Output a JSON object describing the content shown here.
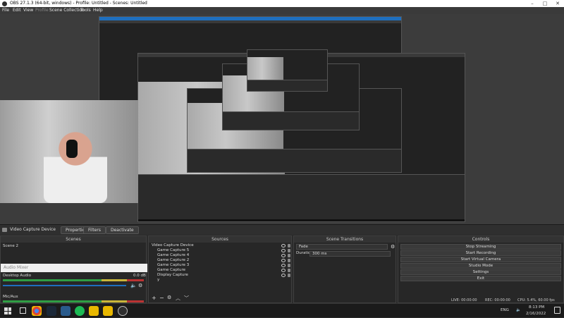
{
  "window": {
    "title": "OBS 27.1.3 (64-bit, windows) - Profile: Untitled - Scenes: Untitled"
  },
  "menu": {
    "items": [
      "File",
      "Edit",
      "View",
      "Profile",
      "Scene Collection",
      "Tools",
      "Help"
    ]
  },
  "source_toolbar": {
    "source_name": "Video Capture Device",
    "properties_label": "Properties",
    "filters_label": "Filters",
    "deactivate_label": "Deactivate"
  },
  "scenes": {
    "header": "Scenes",
    "items": [
      "Scene 2"
    ]
  },
  "sources": {
    "header": "Sources",
    "items": [
      "Video Capture Device",
      "Game Capture 5",
      "Game Capture 4",
      "Game Capture 2",
      "Game Capture 3",
      "Game Capture",
      "Display Capture",
      "y"
    ]
  },
  "audio_mixer": {
    "header": "Audio Mixer",
    "desktop": {
      "label": "Desktop Audio",
      "db": "0.0 dB"
    },
    "mic": {
      "label": "Mic/Aux"
    }
  },
  "transitions": {
    "header": "Scene Transitions",
    "type": "Fade",
    "duration_label": "Duration",
    "duration_value": "300 ms"
  },
  "controls": {
    "header": "Controls",
    "buttons": [
      "Stop Streaming",
      "Start Recording",
      "Start Virtual Camera",
      "Studio Mode",
      "Settings",
      "Exit"
    ]
  },
  "status": {
    "live": "LIVE: 00:00:00",
    "rec": "REC: 00:00:00",
    "cpu": "CPU: 5.4%, 60.00 fps"
  },
  "taskbar": {
    "time": "8:13 PM",
    "date": "2/16/2022",
    "lang": "ENG"
  },
  "colors": {
    "accent": "#1e6fbf",
    "panel_bg": "#272727",
    "title_bar": "#ffffff"
  }
}
